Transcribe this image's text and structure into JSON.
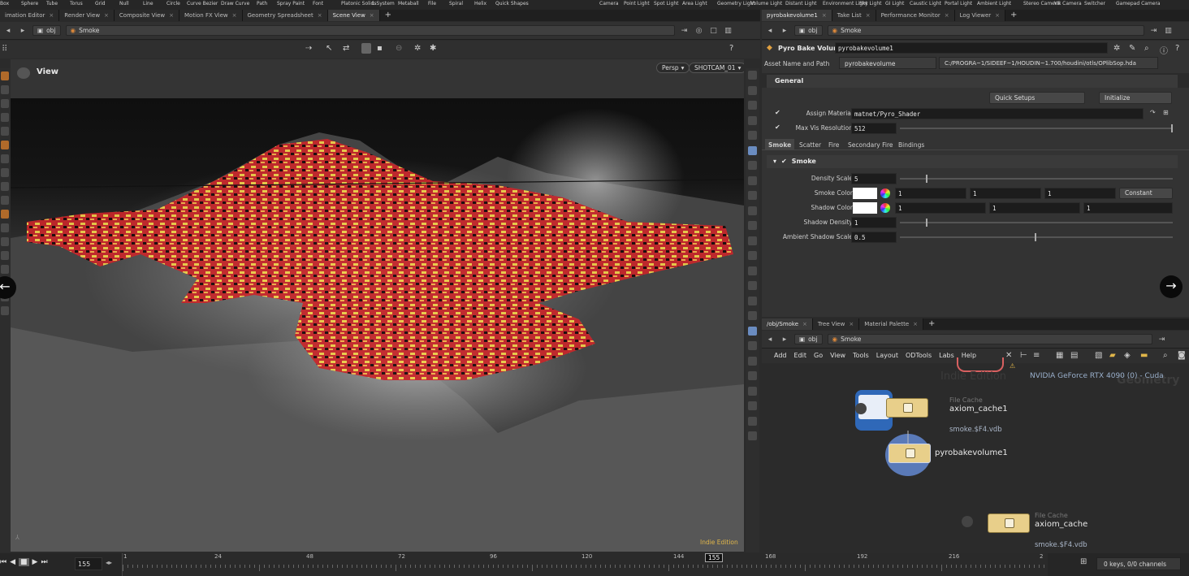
{
  "shelf_tools": [
    "Box",
    "Sphere",
    "Tube",
    "Torus",
    "Grid",
    "Null",
    "Line",
    "Circle",
    "Curve Bezier",
    "Draw Curve",
    "Path",
    "Spray Paint",
    "Font",
    "Platonic Solids",
    "L-System",
    "Metaball",
    "File",
    "Spiral",
    "Helix",
    "Quick Shapes",
    "Camera",
    "Point Light",
    "Spot Light",
    "Area Light",
    "Geometry Light",
    "Volume Light",
    "Distant Light",
    "Environment Light",
    "Sky Light",
    "GI Light",
    "Caustic Light",
    "Portal Light",
    "Ambient Light",
    "Stereo Camera",
    "VR Camera",
    "Switcher",
    "Gamepad Camera"
  ],
  "left_tabs": [
    "imation Editor",
    "Render View",
    "Composite View",
    "Motion FX View",
    "Geometry Spreadsheet",
    "Scene View"
  ],
  "left_path": {
    "network": "obj",
    "node": "Smoke"
  },
  "viewport": {
    "title": "View",
    "camera_mode": "Persp",
    "camera": "SHOTCAM_01",
    "watermark": "Indie Edition"
  },
  "right_tabs": [
    "pyrobakevolume1",
    "Take List",
    "Performance Monitor",
    "Log Viewer"
  ],
  "right_path": {
    "network": "obj",
    "node": "Smoke"
  },
  "params": {
    "node_type": "Pyro Bake Volume",
    "node_name": "pyrobakevolume1",
    "asset_label": "Asset Name and Path",
    "asset_name": "pyrobakevolume",
    "asset_path": "C:/PROGRA~1/SIDEEF~1/HOUDIN~1.700/houdini/otls/OPlibSop.hda",
    "section": "General",
    "quick_setups": "Quick Setups",
    "initialize": "Initialize",
    "assign_material_label": "Assign Material",
    "assign_material": "matnet/Pyro_Shader",
    "max_vis_label": "Max Vis Resolution",
    "max_vis": "512",
    "tabs": [
      "Smoke",
      "Scatter",
      "Fire",
      "Secondary Fire",
      "Bindings"
    ],
    "smoke_header": "Smoke",
    "density_label": "Density Scale",
    "density": "5",
    "smoke_color_label": "Smoke Color",
    "smoke_color": [
      "1",
      "1",
      "1"
    ],
    "smoke_color_mode": "Constant",
    "shadow_color_label": "Shadow Color",
    "shadow_color": [
      "1",
      "1",
      "1"
    ],
    "shadow_density_label": "Shadow Density",
    "shadow_density": "1",
    "ambient_label": "Ambient Shadow Scale",
    "ambient": "0.5"
  },
  "net_tabs": [
    "/obj/Smoke",
    "Tree View",
    "Material Palette"
  ],
  "net_path": {
    "network": "obj",
    "node": "Smoke"
  },
  "net_menu": [
    "Add",
    "Edit",
    "Go",
    "View",
    "Tools",
    "Layout",
    "ODTools",
    "Labs",
    "Help"
  ],
  "network": {
    "watermark_left": "Indie Edition",
    "watermark_right": "Geometry",
    "gpu": "NVIDIA GeForce RTX 4090 (0) - Cuda",
    "nodes": [
      {
        "type": "File Cache",
        "name": "axiom_cache1",
        "file": "smoke.$F4.vdb"
      },
      {
        "name": "pyrobakevolume1"
      },
      {
        "type": "File Cache",
        "name": "axiom_cache",
        "file": "smoke.$F4.vdb"
      }
    ]
  },
  "timeline": {
    "frame": "155",
    "marker": "155",
    "ticks": [
      "1",
      "24",
      "48",
      "72",
      "96",
      "120",
      "144",
      "168",
      "192",
      "216",
      "2"
    ],
    "keys": "0 keys, 0/0 channels"
  },
  "colors": {
    "accent": "#e0b64a",
    "fire_red": "#d83a2a",
    "fire_yellow": "#f2d24a",
    "node_gold": "#e8cf8a"
  }
}
